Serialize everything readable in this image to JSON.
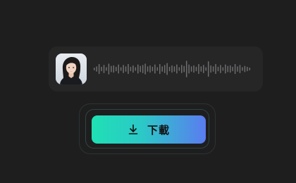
{
  "audio": {
    "avatar_icon": "portrait-avatar",
    "waveform_levels": [
      0.15,
      0.3,
      0.55,
      0.25,
      0.45,
      0.2,
      0.6,
      0.35,
      0.4,
      0.25,
      0.5,
      0.2,
      0.45,
      0.3,
      0.55,
      0.25,
      0.4,
      0.2,
      0.5,
      0.35,
      0.45,
      0.6,
      0.3,
      0.4,
      0.25,
      0.5,
      0.2,
      0.55,
      0.3,
      0.45,
      0.65,
      0.25,
      0.4,
      0.3,
      0.5,
      0.2,
      0.45,
      0.35,
      0.9,
      0.5,
      0.3,
      0.4,
      0.25,
      0.55,
      0.3,
      0.45,
      0.2,
      0.85,
      0.4,
      0.3,
      0.55,
      0.25,
      0.45,
      0.2,
      0.5,
      0.35,
      0.4,
      0.25,
      0.55,
      0.3,
      0.45,
      0.2,
      0.35,
      0.25,
      0.15
    ],
    "waveform_color": "#6e6e70"
  },
  "download": {
    "label": "下載",
    "icon": "download-icon",
    "gradient_start": "#1fe0b4",
    "gradient_end": "#5a7cf0"
  }
}
